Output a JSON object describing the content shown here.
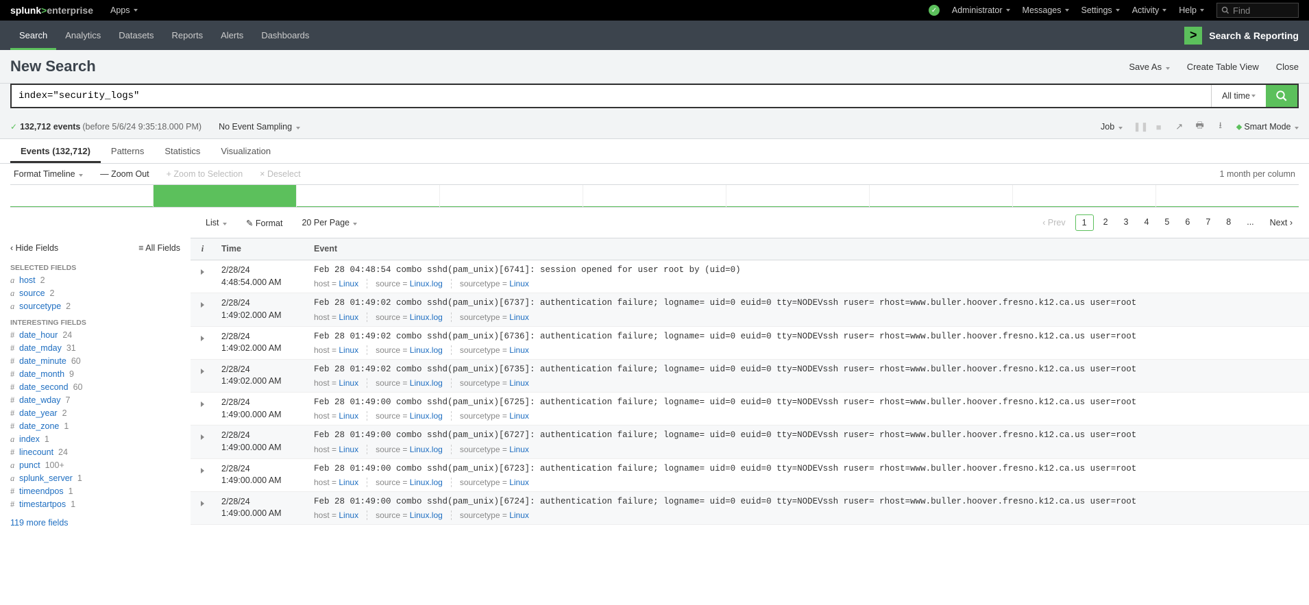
{
  "topbar": {
    "brand_pre": "splunk",
    "brand_mid": ">",
    "brand_post": "enterprise",
    "apps": "Apps",
    "menus": [
      "Administrator",
      "Messages",
      "Settings",
      "Activity",
      "Help"
    ],
    "find_placeholder": "Find"
  },
  "navbar": {
    "items": [
      "Search",
      "Analytics",
      "Datasets",
      "Reports",
      "Alerts",
      "Dashboards"
    ],
    "right_label": "Search & Reporting",
    "right_icon": ">"
  },
  "titlebar": {
    "title": "New Search",
    "actions": [
      "Save As",
      "Create Table View",
      "Close"
    ]
  },
  "search": {
    "query": "index=\"security_logs\"",
    "timerange": "All time"
  },
  "status": {
    "count_text": "132,712 events",
    "ts_text": "(before 5/6/24 9:35:18.000 PM)",
    "sampling": "No Event Sampling",
    "job": "Job",
    "mode": "Smart Mode"
  },
  "tabs": {
    "events": "Events (132,712)",
    "patterns": "Patterns",
    "statistics": "Statistics",
    "visualization": "Visualization"
  },
  "timeline_ctrl": {
    "format": "Format Timeline",
    "zoom_out": "— Zoom Out",
    "zoom_sel": "+ Zoom to Selection",
    "deselect": "× Deselect",
    "scale": "1 month per column"
  },
  "timeline_bars": [
    0,
    100,
    2,
    2,
    2,
    4,
    0,
    0,
    0
  ],
  "results_tools": {
    "list": "List",
    "format": "Format",
    "perpage": "20 Per Page",
    "prev": "Prev",
    "next": "Next",
    "pages": [
      "1",
      "2",
      "3",
      "4",
      "5",
      "6",
      "7",
      "8",
      "..."
    ]
  },
  "fieldsbar": {
    "hide": "Hide Fields",
    "all": "All Fields",
    "selected_label": "Selected Fields",
    "selected": [
      {
        "t": "a",
        "name": "host",
        "c": "2"
      },
      {
        "t": "a",
        "name": "source",
        "c": "2"
      },
      {
        "t": "a",
        "name": "sourcetype",
        "c": "2"
      }
    ],
    "interesting_label": "Interesting Fields",
    "interesting": [
      {
        "t": "#",
        "name": "date_hour",
        "c": "24"
      },
      {
        "t": "#",
        "name": "date_mday",
        "c": "31"
      },
      {
        "t": "#",
        "name": "date_minute",
        "c": "60"
      },
      {
        "t": "#",
        "name": "date_month",
        "c": "9"
      },
      {
        "t": "#",
        "name": "date_second",
        "c": "60"
      },
      {
        "t": "#",
        "name": "date_wday",
        "c": "7"
      },
      {
        "t": "#",
        "name": "date_year",
        "c": "2"
      },
      {
        "t": "#",
        "name": "date_zone",
        "c": "1"
      },
      {
        "t": "a",
        "name": "index",
        "c": "1"
      },
      {
        "t": "#",
        "name": "linecount",
        "c": "24"
      },
      {
        "t": "a",
        "name": "punct",
        "c": "100+"
      },
      {
        "t": "a",
        "name": "splunk_server",
        "c": "1"
      },
      {
        "t": "#",
        "name": "timeendpos",
        "c": "1"
      },
      {
        "t": "#",
        "name": "timestartpos",
        "c": "1"
      }
    ],
    "more": "119 more fields"
  },
  "events_table": {
    "h_i": "i",
    "h_time": "Time",
    "h_event": "Event",
    "field_labels": {
      "host": "host =",
      "source": "source =",
      "sourcetype": "sourcetype ="
    },
    "field_values": {
      "host": "Linux",
      "source": "Linux.log",
      "sourcetype": "Linux"
    },
    "rows": [
      {
        "t1": "2/28/24",
        "t2": "4:48:54.000 AM",
        "raw": "Feb 28 04:48:54 combo sshd(pam_unix)[6741]: session opened for user root by (uid=0)"
      },
      {
        "t1": "2/28/24",
        "t2": "1:49:02.000 AM",
        "raw": "Feb 28 01:49:02 combo sshd(pam_unix)[6737]: authentication failure; logname= uid=0 euid=0 tty=NODEVssh ruser= rhost=www.buller.hoover.fresno.k12.ca.us  user=root"
      },
      {
        "t1": "2/28/24",
        "t2": "1:49:02.000 AM",
        "raw": "Feb 28 01:49:02 combo sshd(pam_unix)[6736]: authentication failure; logname= uid=0 euid=0 tty=NODEVssh ruser= rhost=www.buller.hoover.fresno.k12.ca.us  user=root"
      },
      {
        "t1": "2/28/24",
        "t2": "1:49:02.000 AM",
        "raw": "Feb 28 01:49:02 combo sshd(pam_unix)[6735]: authentication failure; logname= uid=0 euid=0 tty=NODEVssh ruser= rhost=www.buller.hoover.fresno.k12.ca.us  user=root"
      },
      {
        "t1": "2/28/24",
        "t2": "1:49:00.000 AM",
        "raw": "Feb 28 01:49:00 combo sshd(pam_unix)[6725]: authentication failure; logname= uid=0 euid=0 tty=NODEVssh ruser= rhost=www.buller.hoover.fresno.k12.ca.us  user=root"
      },
      {
        "t1": "2/28/24",
        "t2": "1:49:00.000 AM",
        "raw": "Feb 28 01:49:00 combo sshd(pam_unix)[6727]: authentication failure; logname= uid=0 euid=0 tty=NODEVssh ruser= rhost=www.buller.hoover.fresno.k12.ca.us  user=root"
      },
      {
        "t1": "2/28/24",
        "t2": "1:49:00.000 AM",
        "raw": "Feb 28 01:49:00 combo sshd(pam_unix)[6723]: authentication failure; logname= uid=0 euid=0 tty=NODEVssh ruser= rhost=www.buller.hoover.fresno.k12.ca.us  user=root"
      },
      {
        "t1": "2/28/24",
        "t2": "1:49:00.000 AM",
        "raw": "Feb 28 01:49:00 combo sshd(pam_unix)[6724]: authentication failure; logname= uid=0 euid=0 tty=NODEVssh ruser= rhost=www.buller.hoover.fresno.k12.ca.us  user=root"
      }
    ]
  }
}
